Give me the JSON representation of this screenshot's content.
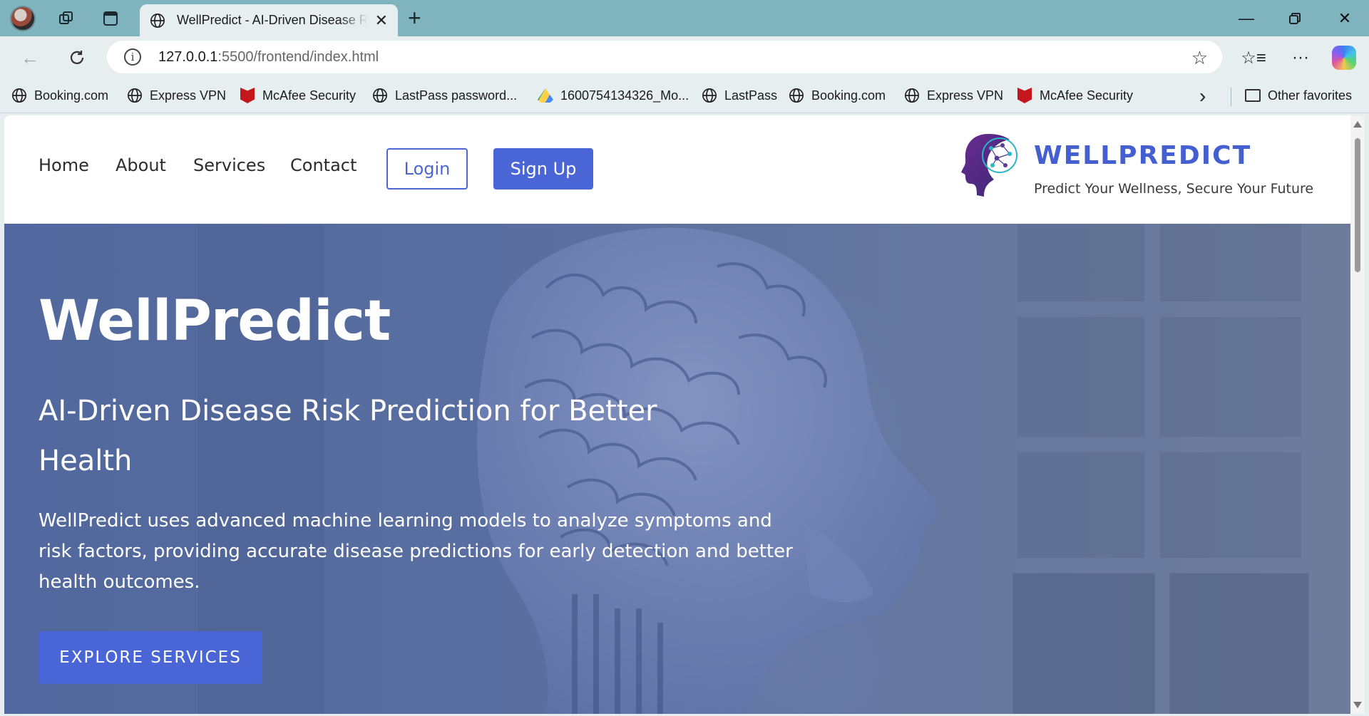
{
  "browser": {
    "tab_title": "WellPredict - AI-Driven Disease Risk Prediction",
    "url_host": "127.0.0.1",
    "url_path": ":5500/frontend/index.html",
    "favorites": [
      {
        "label": "Booking.com",
        "icon": "globe-icon"
      },
      {
        "label": "Express VPN",
        "icon": "globe-icon"
      },
      {
        "label": "McAfee Security",
        "icon": "mcafee-icon"
      },
      {
        "label": "LastPass password...",
        "icon": "globe-icon"
      },
      {
        "label": "1600754134326_Mo...",
        "icon": "google-drive-icon"
      },
      {
        "label": "LastPass",
        "icon": "globe-icon"
      },
      {
        "label": "Booking.com",
        "icon": "globe-icon"
      },
      {
        "label": "Express VPN",
        "icon": "globe-icon"
      },
      {
        "label": "McAfee Security",
        "icon": "mcafee-icon"
      }
    ],
    "other_favorites": "Other favorites"
  },
  "site": {
    "nav": {
      "home": "Home",
      "about": "About",
      "services": "Services",
      "contact": "Contact",
      "login": "Login",
      "signup": "Sign Up"
    },
    "brand": {
      "name": "WELLPREDICT",
      "tagline": "Predict Your Wellness, Secure Your Future"
    },
    "hero": {
      "title": "WellPredict",
      "subtitle": "AI-Driven Disease Risk Prediction for Better Health",
      "description": "WellPredict uses advanced machine learning models to analyze symptoms and risk factors, providing accurate disease predictions for early detection and better health outcomes.",
      "cta": "EXPLORE SERVICES"
    }
  },
  "colors": {
    "accent": "#4a66d6",
    "brand": "#4460d0",
    "tabbar": "#7fb4bf"
  }
}
